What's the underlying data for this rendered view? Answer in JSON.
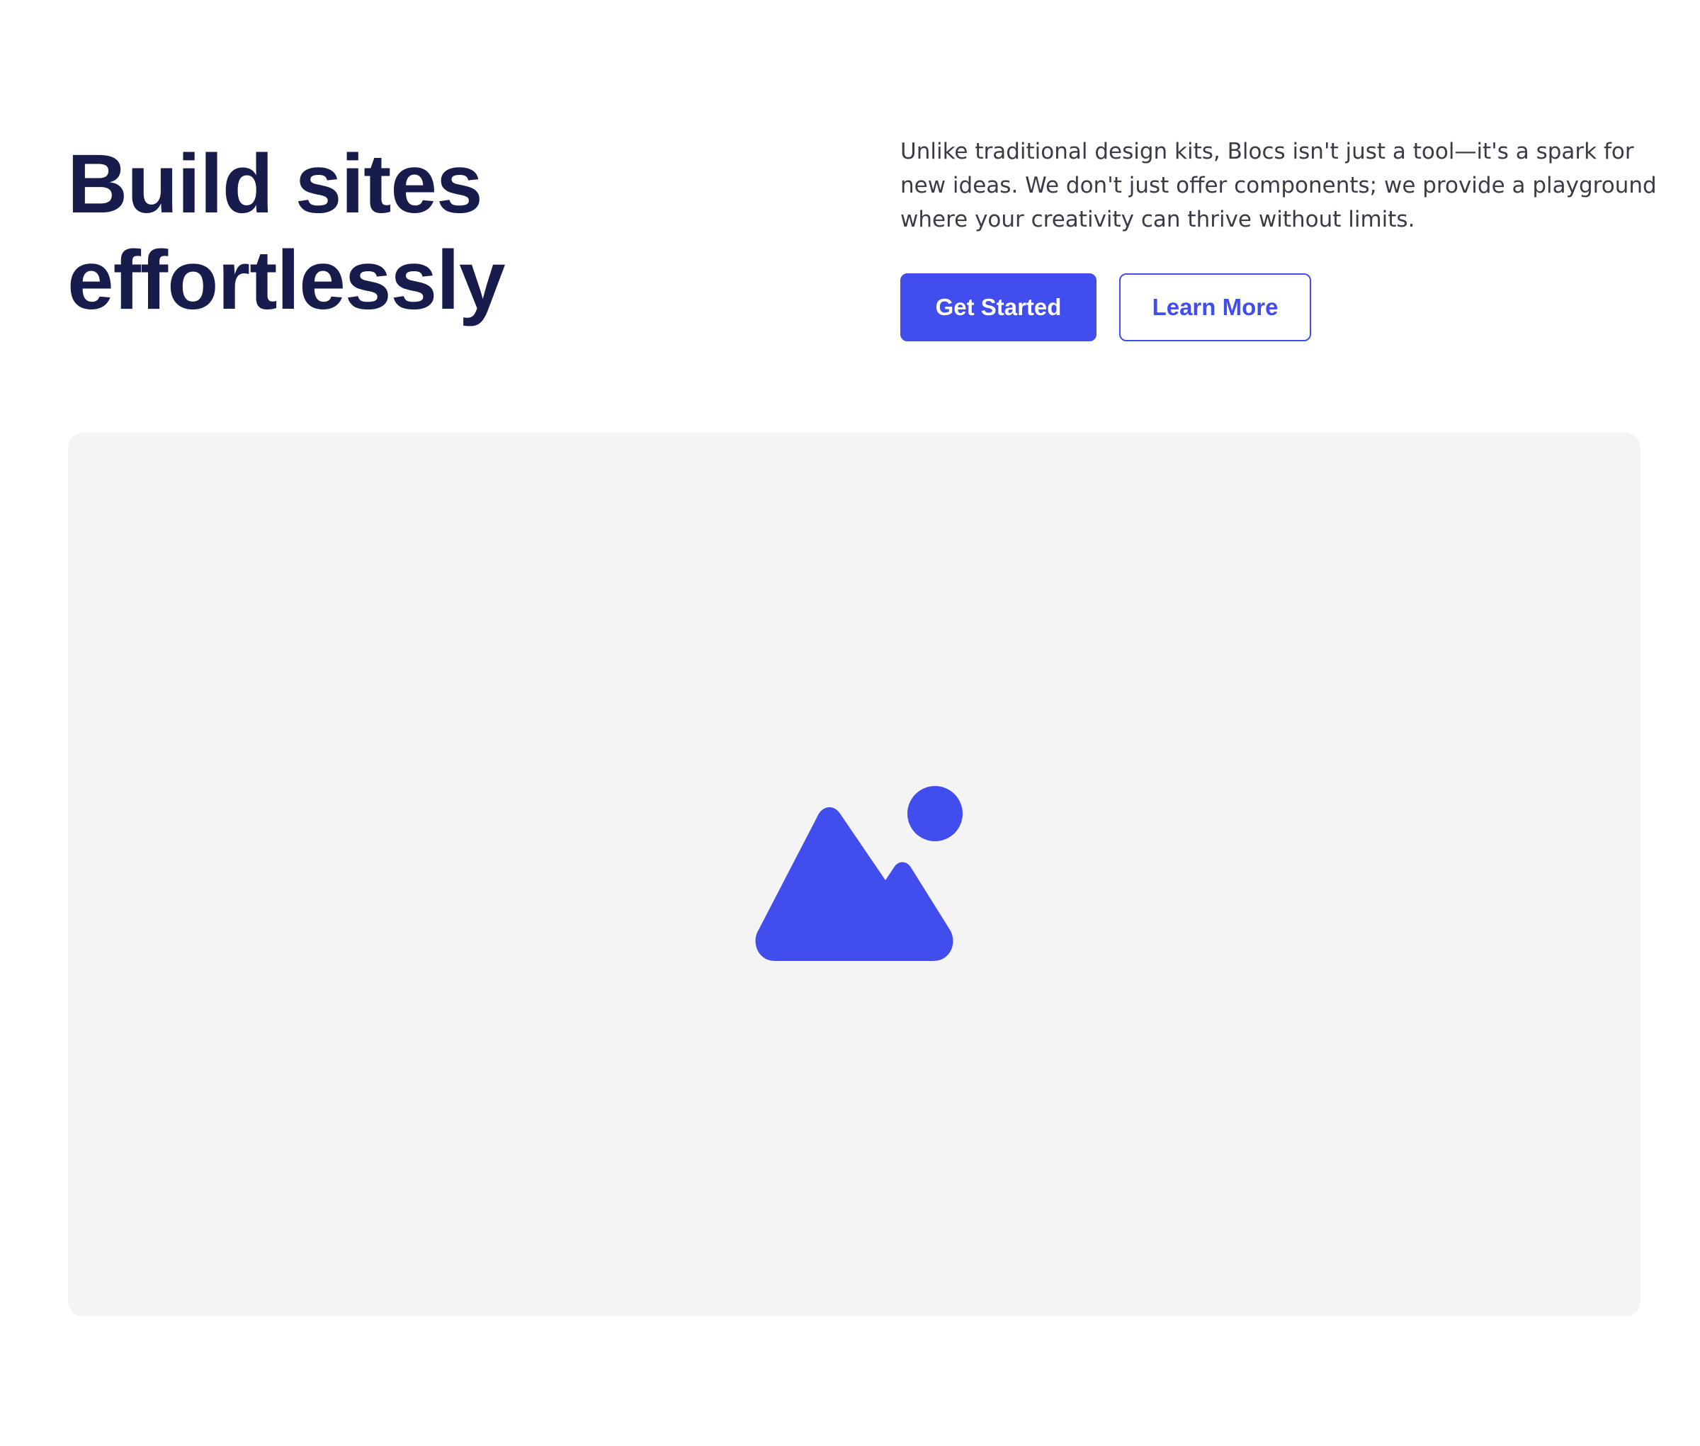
{
  "hero": {
    "title_line1": "Build sites",
    "title_line2": "effortlessly",
    "description": "Unlike traditional design kits, Blocs isn't just a tool—it's a spark for new ideas. We don't just offer components; we provide a playground where your creativity can thrive without limits.",
    "primary_button_label": "Get Started",
    "secondary_button_label": "Learn More"
  },
  "media": {
    "icon": "image-placeholder-icon"
  },
  "colors": {
    "accent": "#424ded",
    "heading": "#171c4d",
    "body_text": "#3a3b46",
    "panel_background": "#f4f4f4",
    "page_background": "#ffffff"
  }
}
